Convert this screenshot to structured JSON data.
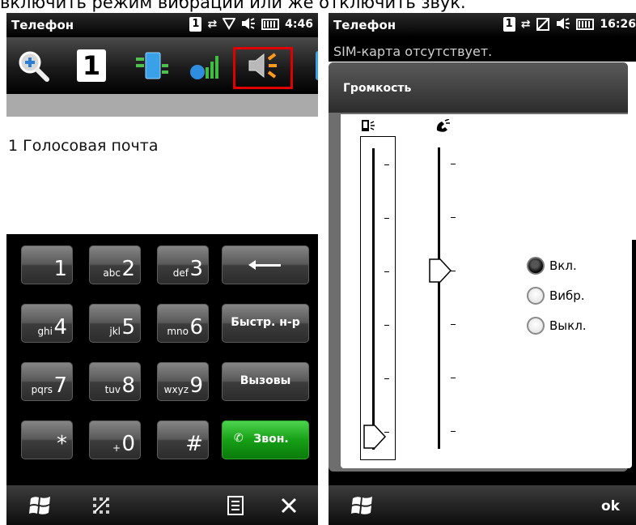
{
  "caption": "включить режим вибрации или же отключить звук.",
  "left": {
    "status": {
      "title": "Телефон",
      "sim": "1",
      "time": "4:46"
    },
    "contacts": {
      "entry": "1  Голосовая почта"
    },
    "keypad": [
      {
        "digit": "1",
        "letters": ""
      },
      {
        "digit": "2",
        "letters": "abc"
      },
      {
        "digit": "3",
        "letters": "def"
      },
      {
        "digit": "4",
        "letters": "ghi"
      },
      {
        "digit": "5",
        "letters": "jkl"
      },
      {
        "digit": "6",
        "letters": "mno"
      },
      {
        "digit": "7",
        "letters": "pqrs"
      },
      {
        "digit": "8",
        "letters": "tuv"
      },
      {
        "digit": "9",
        "letters": "wxyz"
      },
      {
        "digit": "*",
        "letters": ""
      },
      {
        "digit": "0",
        "letters": "+"
      },
      {
        "digit": "#",
        "letters": ""
      }
    ],
    "speed_dial": "Быстр. н-р",
    "calls": "Вызовы",
    "call": "Звон."
  },
  "right": {
    "status": {
      "title": "Телефон",
      "sim": "1",
      "time": "16:26"
    },
    "sim_message": "SIM-карта отсутствует.",
    "dialog_title": "Громкость",
    "ringer_level": 0,
    "voice_level": 0.6,
    "radio": [
      {
        "label": "Вкл.",
        "selected": true
      },
      {
        "label": "Вибр.",
        "selected": false
      },
      {
        "label": "Выкл.",
        "selected": false
      }
    ],
    "ok": "ok"
  }
}
